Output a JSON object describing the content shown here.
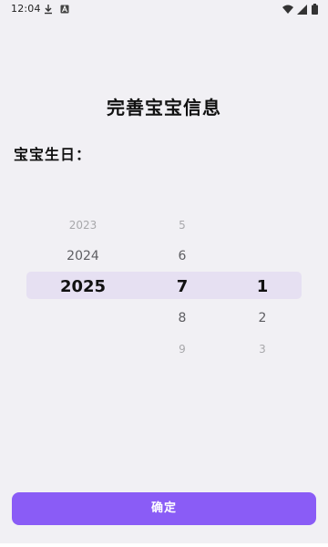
{
  "status_bar": {
    "time": "12:04",
    "left_icons": [
      "download-icon",
      "text-a-icon"
    ],
    "right_icons": [
      "wifi-icon",
      "signal-icon",
      "battery-icon"
    ]
  },
  "page": {
    "title": "完善宝宝信息",
    "birthday_label": "宝宝生日："
  },
  "date_picker": {
    "selected": {
      "year": "2025",
      "month": "7",
      "day": "1"
    },
    "year_column": [
      "2023",
      "2024",
      "2025"
    ],
    "month_column": [
      "5",
      "6",
      "7",
      "8",
      "9"
    ],
    "day_column": [
      "1",
      "2",
      "3"
    ]
  },
  "colors": {
    "background": "#f1f0f4",
    "selection_highlight": "#e6e0f2",
    "primary_button": "#8a5cf6"
  },
  "actions": {
    "confirm_label": "确定"
  }
}
